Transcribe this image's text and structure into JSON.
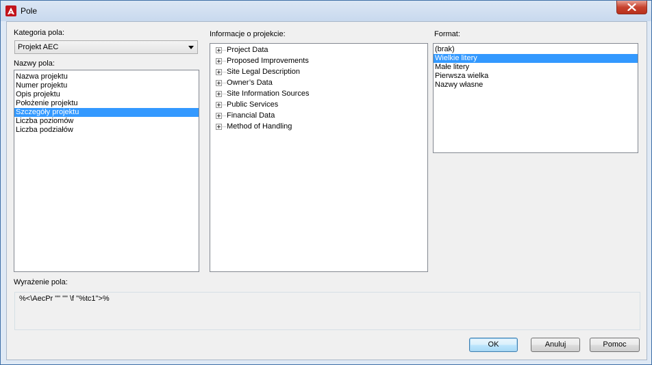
{
  "window": {
    "title": "Pole",
    "app_icon": "autocad-a-icon",
    "close_icon": "close-icon"
  },
  "category": {
    "label": "Kategoria pola:",
    "selected": "Projekt AEC"
  },
  "field_names": {
    "label": "Nazwy pola:",
    "items": [
      "Nazwa projektu",
      "Numer projektu",
      "Opis projektu",
      "Położenie projektu",
      "Szczegóły projektu",
      "Liczba poziomów",
      "Liczba podziałów"
    ],
    "selected_index": 4
  },
  "project_info": {
    "label": "Informacje o projekcie:",
    "items": [
      "Project Data",
      "Proposed Improvements",
      "Site Legal Description",
      "Owner’s Data",
      "Site Information Sources",
      "Public Services",
      "Financial Data",
      "Method of Handling"
    ]
  },
  "format": {
    "label": "Format:",
    "items": [
      "(brak)",
      "Wielkie litery",
      "Małe litery",
      "Pierwsza wielka",
      "Nazwy własne"
    ],
    "selected_index": 1
  },
  "expression": {
    "label": "Wyrażenie pola:",
    "value": "%<\\AecPr \"\" \"\" \\f \"%tc1\">%"
  },
  "buttons": {
    "ok": "OK",
    "cancel": "Anuluj",
    "help": "Pomoc"
  },
  "colors": {
    "selection": "#3399ff",
    "title_bar": "#c8d9ee",
    "close_button": "#c7432f"
  }
}
